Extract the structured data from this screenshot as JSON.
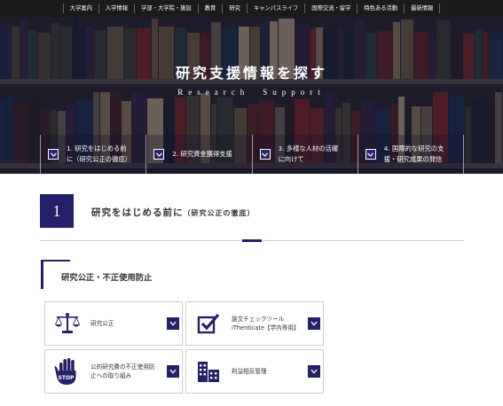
{
  "nav": {
    "items": [
      "大学案内",
      "入学情報",
      "学部・大学院・施設",
      "教育",
      "研究",
      "キャンパスライフ",
      "国際交流・留学",
      "特色ある活動",
      "最新情報"
    ]
  },
  "hero": {
    "title": "研究支援情報を探す",
    "subtitle": "Research　Support",
    "tabs": [
      {
        "line1": "1. 研究をはじめる前",
        "line2": "に（研究公正の徹底）"
      },
      {
        "line1": "2. 研究資金獲得支援",
        "line2": ""
      },
      {
        "line1": "3. 多様な人材の活躍",
        "line2": "に向けて"
      },
      {
        "line1": "4. 国際的な研究の支",
        "line2": "援・研究成果の発信"
      }
    ]
  },
  "section": {
    "number": "1",
    "title": "研究をはじめる前に",
    "title_note": "（研究公正の徹底）"
  },
  "subsection": {
    "title": "研究公正・不正使用防止"
  },
  "cards": [
    {
      "line1": "研究公正",
      "line2": "",
      "icon": "scales-icon"
    },
    {
      "line1": "論文チェックツール",
      "line2": "iThenticate【学内専用】",
      "icon": "checkbox-icon"
    },
    {
      "line1": "公的研究費の不正使用防",
      "line2": "止への取り組み",
      "icon": "stop-hand-icon"
    },
    {
      "line1": "利益相反管理",
      "line2": "",
      "icon": "building-icon"
    }
  ],
  "colors": {
    "accent": "#252167",
    "nav_bg": "#1b1b1b"
  }
}
